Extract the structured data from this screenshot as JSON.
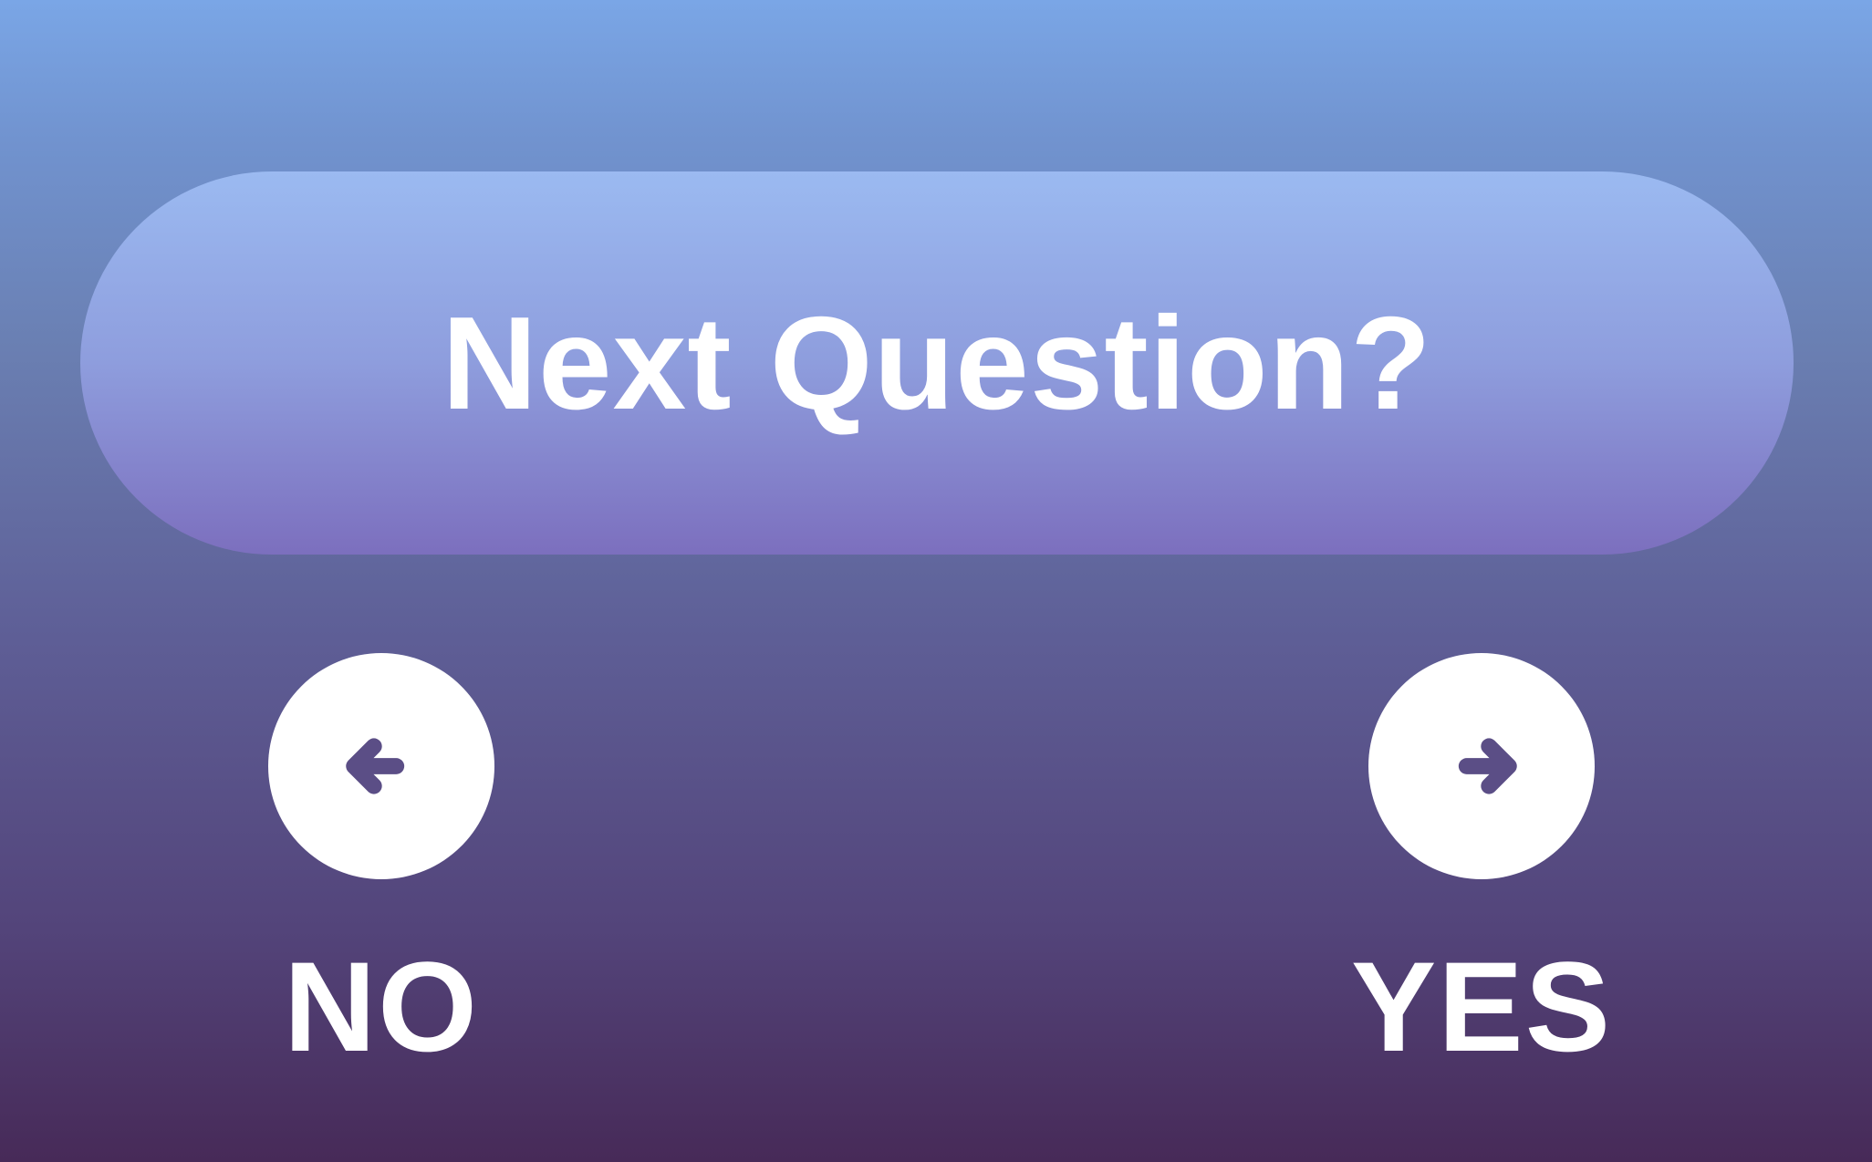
{
  "question": {
    "text": "Next Question?"
  },
  "choices": {
    "no": {
      "label": "NO",
      "icon": "arrow-left-icon"
    },
    "yes": {
      "label": "YES",
      "icon": "arrow-right-icon"
    }
  },
  "colors": {
    "background_top": "#7aa6e6",
    "background_bottom": "#472a58",
    "banner_top": "#9bbaf1",
    "banner_bottom": "#7c6fbe",
    "button_fill": "#ffffff",
    "arrow": "#5b4e86",
    "text": "#ffffff"
  }
}
